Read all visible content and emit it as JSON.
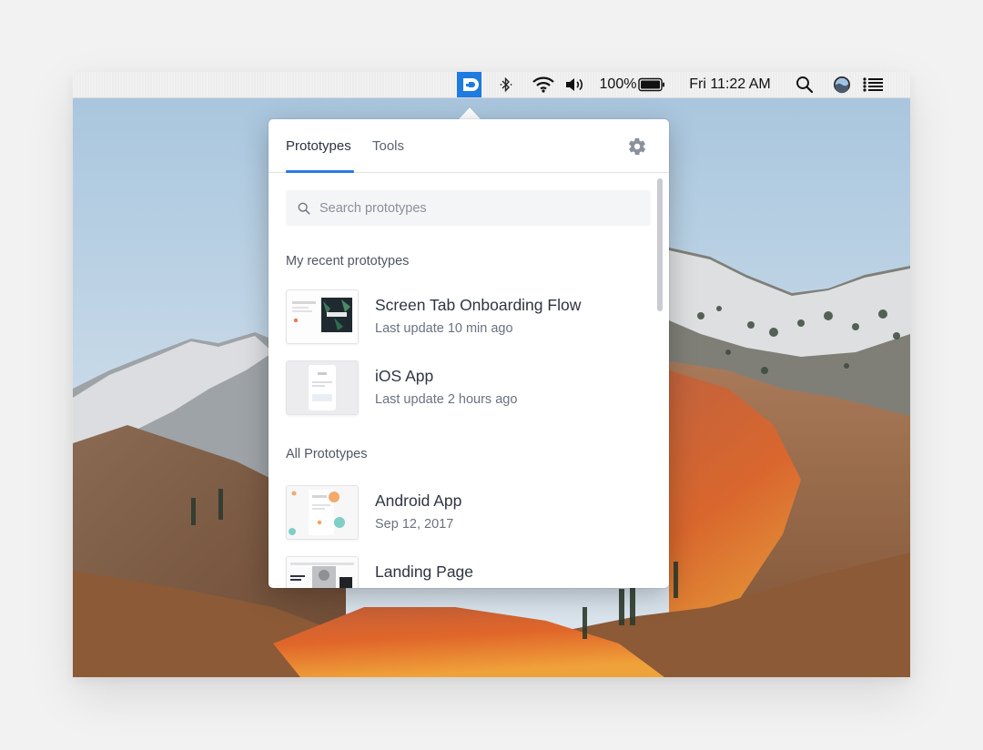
{
  "menubar": {
    "app_icon": "cloud-app-icon",
    "bluetooth_icon": "bluetooth-icon",
    "wifi_icon": "wifi-icon",
    "volume_icon": "volume-icon",
    "battery_percent": "100%",
    "battery_icon": "battery-icon",
    "clock": "Fri 11:22 AM",
    "search_icon": "search-icon",
    "user_icon": "user-avatar-icon",
    "list_icon": "notification-list-icon"
  },
  "popover": {
    "tabs": [
      {
        "label": "Prototypes",
        "active": true
      },
      {
        "label": "Tools",
        "active": false
      }
    ],
    "settings_icon": "gear-icon",
    "search": {
      "placeholder": "Search prototypes",
      "value": ""
    },
    "recent_section": {
      "title": "My recent prototypes",
      "items": [
        {
          "title": "Screen Tab Onboarding Flow",
          "subtitle": "Last update 10 min ago"
        },
        {
          "title": "iOS App",
          "subtitle": "Last update 2 hours ago"
        }
      ]
    },
    "all_section": {
      "title": "All Prototypes",
      "items": [
        {
          "title": "Android App",
          "subtitle": "Sep 12, 2017"
        },
        {
          "title": "Landing Page",
          "subtitle": ""
        }
      ]
    }
  },
  "colors": {
    "accent": "#2c7be5",
    "app_icon_bg": "#1e7be0",
    "menubar_bg": "#ededed"
  }
}
